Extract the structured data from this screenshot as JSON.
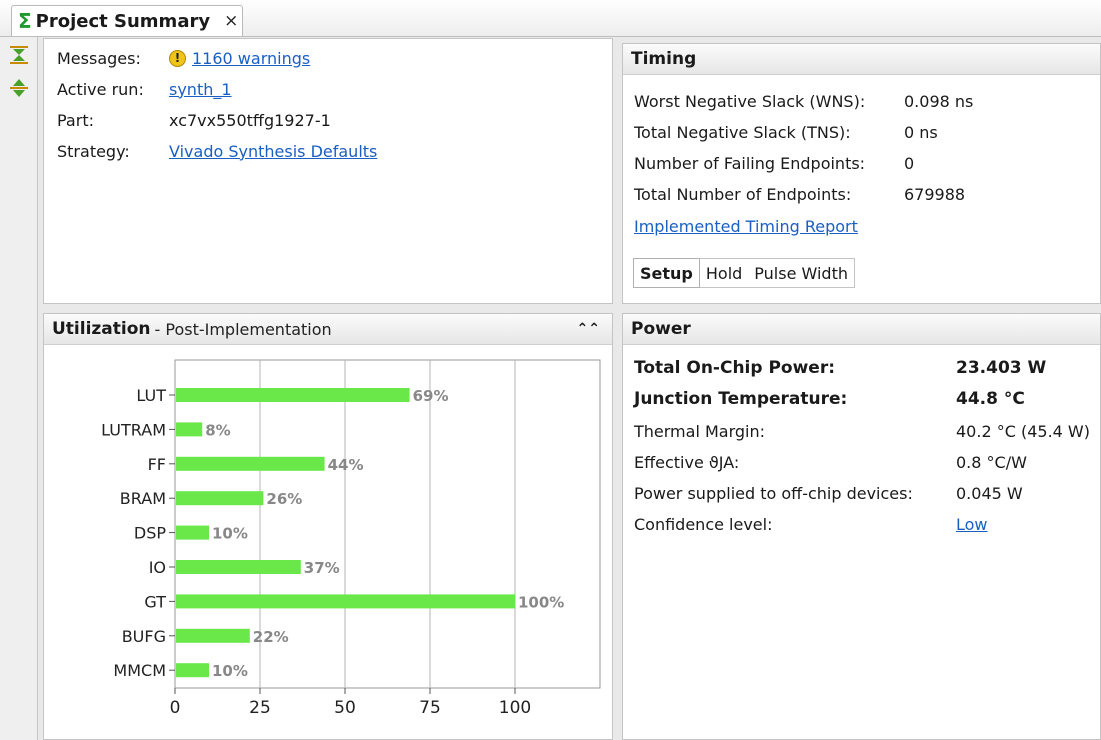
{
  "tab": {
    "icon": "sigma-icon",
    "title": "Project Summary",
    "close": "×"
  },
  "summary": {
    "messages_label": "Messages:",
    "messages_value": "1160 warnings",
    "active_run_label": "Active run:",
    "active_run_value": "synth_1",
    "part_label": "Part:",
    "part_value": "xc7vx550tffg1927-1",
    "strategy_label": "Strategy:",
    "strategy_value": "Vivado Synthesis Defaults"
  },
  "timing": {
    "title": "Timing",
    "rows": [
      {
        "label": "Worst Negative Slack (WNS):",
        "value": "0.098 ns"
      },
      {
        "label": "Total Negative Slack (TNS):",
        "value": "0 ns"
      },
      {
        "label": "Number of Failing Endpoints:",
        "value": "0"
      },
      {
        "label": "Total Number of Endpoints:",
        "value": "679988"
      }
    ],
    "report_link": "Implemented Timing Report",
    "tabs": [
      "Setup",
      "Hold",
      "Pulse Width"
    ]
  },
  "utilization": {
    "title": "Utilization",
    "subtitle": "- Post-Implementation",
    "collapse_icon": "chevron-up-double-icon"
  },
  "power": {
    "title": "Power",
    "rows": [
      {
        "label": "Total On-Chip Power:",
        "value": "23.403 W",
        "bold": true
      },
      {
        "label": "Junction Temperature:",
        "value": "44.8 °C",
        "bold": true
      },
      {
        "label": "Thermal Margin:",
        "value": "40.2 °C (45.4 W)",
        "bold": false
      },
      {
        "label": "Effective ϑJA:",
        "value": "0.8 °C/W",
        "bold": false
      },
      {
        "label": "Power supplied to off-chip devices:",
        "value": "0.045 W",
        "bold": false
      },
      {
        "label": "Confidence level:",
        "value": "Low",
        "bold": false,
        "link": true
      }
    ]
  },
  "colors": {
    "bar": "#6ae84a",
    "link": "#1a5fc4",
    "label": "#888888"
  },
  "chart_data": {
    "type": "bar",
    "orientation": "horizontal",
    "categories": [
      "LUT",
      "LUTRAM",
      "FF",
      "BRAM",
      "DSP",
      "IO",
      "GT",
      "BUFG",
      "MMCM"
    ],
    "values": [
      69,
      8,
      44,
      26,
      10,
      37,
      100,
      22,
      10
    ],
    "value_labels": [
      "69%",
      "8%",
      "44%",
      "26%",
      "10%",
      "37%",
      "100%",
      "22%",
      "10%"
    ],
    "xticks": [
      "0",
      "25",
      "50",
      "75",
      "100"
    ],
    "xlim": [
      0,
      125
    ],
    "grid": true
  }
}
